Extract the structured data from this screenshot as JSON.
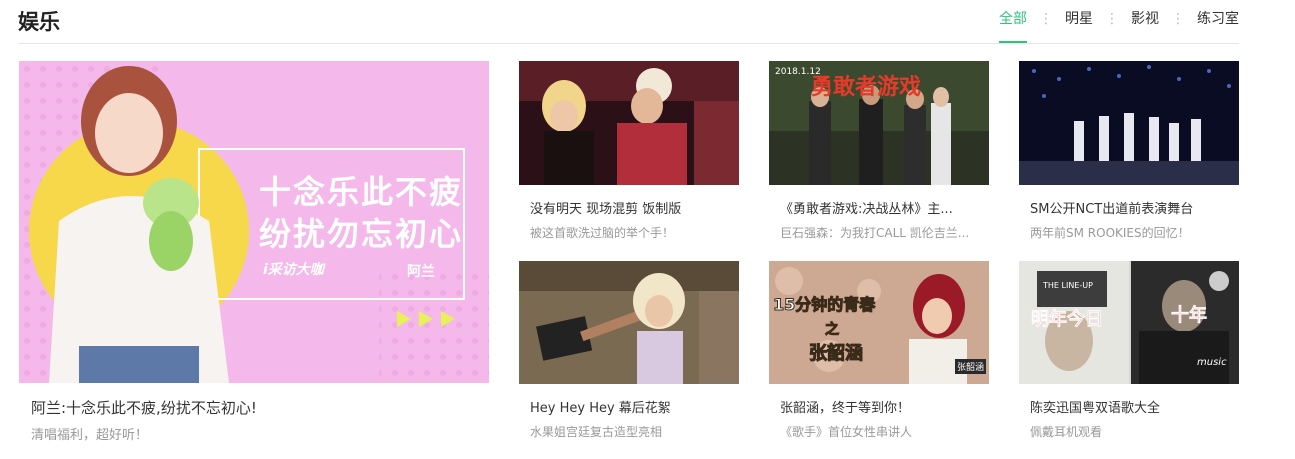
{
  "section": {
    "title": "娱乐"
  },
  "tabs": [
    {
      "label": "全部",
      "active": true
    },
    {
      "label": "明星",
      "active": false
    },
    {
      "label": "影视",
      "active": false
    },
    {
      "label": "练习室",
      "active": false
    }
  ],
  "featured": {
    "title": "阿兰:十念乐此不疲,纷扰不忘初心!",
    "subtitle": "清唱福利，超好听！",
    "poster_line1": "十念乐此不疲",
    "poster_line2": "纷扰勿忘初心",
    "poster_logo": "i采访大咖",
    "poster_name": "阿兰"
  },
  "videos": [
    {
      "title": "没有明天 现场混剪 饭制版",
      "subtitle": "被这首歌洗过脑的举个手！"
    },
    {
      "title": "《勇敢者游戏:决战丛林》主...",
      "subtitle": "巨石强森：为我打CALL 凯伦吉兰...",
      "overlay": "勇敢者游戏",
      "overlay_date": "2018.1.12"
    },
    {
      "title": "SM公开NCT出道前表演舞台",
      "subtitle": "两年前SM ROOKIES的回忆！"
    },
    {
      "title": "Hey Hey Hey 幕后花絮",
      "subtitle": "水果姐宫廷复古造型亮相"
    },
    {
      "title": "张韶涵，终于等到你！",
      "subtitle": "《歌手》首位女性串讲人",
      "overlay": "15分钟的青春",
      "overlay2": "之",
      "overlay3": "张韶涵",
      "overlay_badge": "张韶涵"
    },
    {
      "title": "陈奕迅国粤双语歌大全",
      "subtitle": "佩戴耳机观看",
      "overlay": "明年今日",
      "overlay2": "十年",
      "overlay_sign": "THE LINE-UP",
      "overlay_music": "music"
    }
  ],
  "colors": {
    "accent": "#31c27c",
    "poster_bg": "#f4b8ea",
    "poster_circle": "#f6d84a"
  }
}
